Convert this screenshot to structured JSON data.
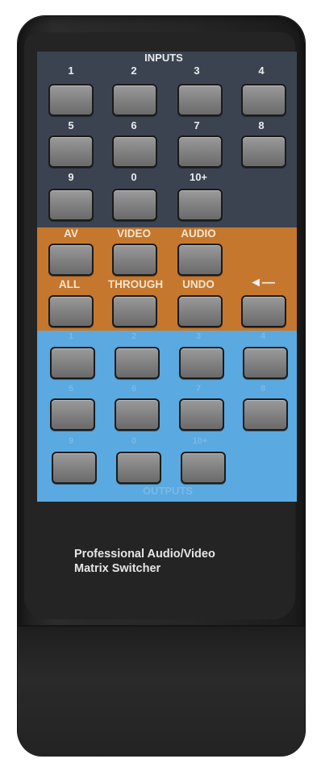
{
  "inputs": {
    "title": "INPUTS",
    "row1": [
      "1",
      "2",
      "3",
      "4"
    ],
    "row2": [
      "5",
      "6",
      "7",
      "8"
    ],
    "row3": [
      "9",
      "0",
      "10+"
    ]
  },
  "modes": {
    "row1": [
      "AV",
      "VIDEO",
      "AUDIO"
    ],
    "row2": [
      "ALL",
      "THROUGH",
      "UNDO"
    ],
    "back_symbol": "◄—"
  },
  "outputs": {
    "title": "OUTPUTS",
    "row1": [
      "1",
      "2",
      "3",
      "4"
    ],
    "row2": [
      "5",
      "6",
      "7",
      "8"
    ],
    "row3": [
      "9",
      "0",
      "10+"
    ]
  },
  "brand": {
    "line1": "Professional Audio/Video",
    "line2": "Matrix Switcher"
  },
  "colors": {
    "inputs_panel": "#3c4350",
    "mode_panel": "#c5772d",
    "outputs_panel": "#5aa9e0",
    "body": "#262626"
  }
}
